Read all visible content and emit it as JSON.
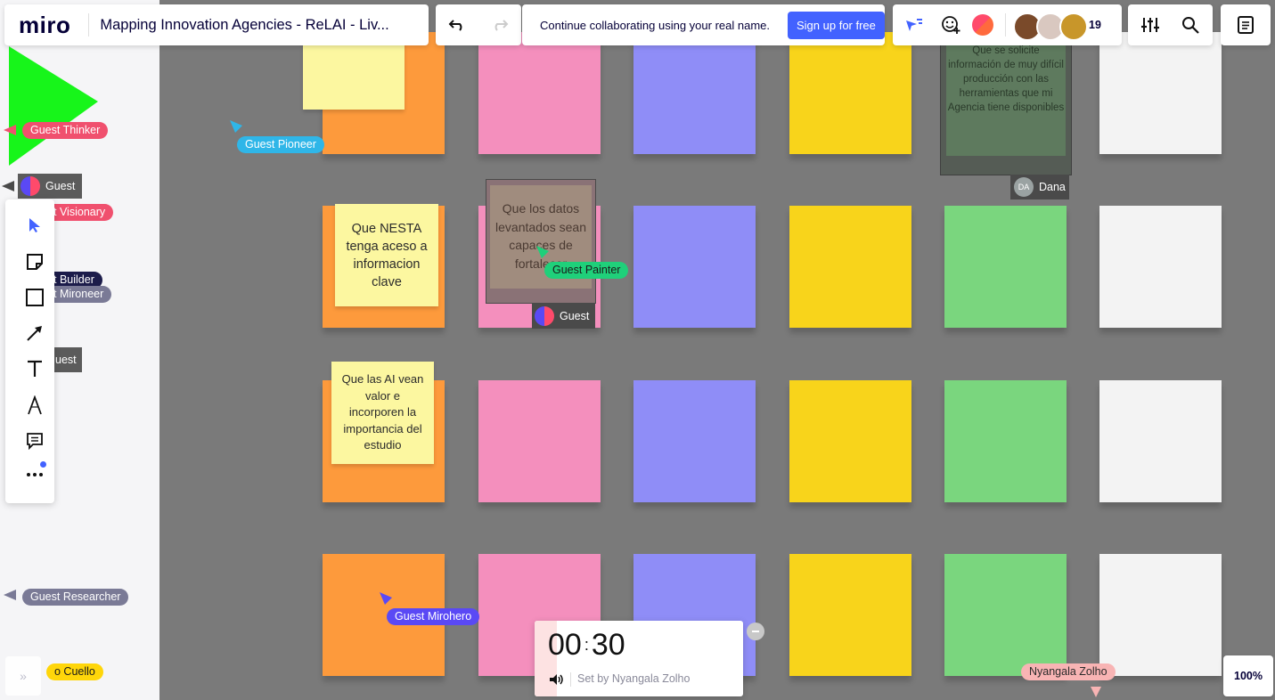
{
  "app": {
    "logo": "miro",
    "board_title": "Mapping Innovation Agencies - ReLAI - Liv...",
    "banner_text": "Continue collaborating using your real name.",
    "signup_label": "Sign up for free",
    "online_count": "19",
    "zoom": "100%"
  },
  "icons": {
    "undo": "undo-icon",
    "redo": "redo-icon",
    "reaction": "reaction-icon",
    "settings": "sliders-icon",
    "search": "search-icon",
    "notes": "notes-icon"
  },
  "toolbar": [
    "select",
    "sticky-note",
    "shape",
    "arrow",
    "text",
    "pen",
    "comment",
    "more"
  ],
  "notes": {
    "nesta": "Que NESTA tenga aceso a informacion clave",
    "ai": "Que las AI vean valor e incorporen la importancia del estudio",
    "datos": "Que los datos levantados sean capaces de fortalecer",
    "solicite": "Que se solicite información de muy difícil producción con las herramientas que mi Agencia tiene disponibles"
  },
  "owner_labels": {
    "dana_initials": "DA",
    "dana": "Dana",
    "guest": "Guest"
  },
  "cursors": {
    "thinker": "Guest Thinker",
    "pioneer": "Guest Pioneer",
    "guest_left": "Guest",
    "visionary": "t Visionary",
    "builder": "t Builder",
    "mironeer": "t Mironeer",
    "guest_left2": "uest",
    "painter": "Guest Painter",
    "researcher": "Guest Researcher",
    "mirohero": "Guest Mirohero",
    "cuello": "o Cuello",
    "nyangala": "Nyangala Zolho"
  },
  "timer": {
    "minutes": "00",
    "seconds": "30",
    "set_by": "Set by Nyangala Zolho"
  },
  "colors": {
    "accent": "#4262ff",
    "orange": "#fd9a3c",
    "pink": "#f48fbd",
    "blue": "#8f8df7",
    "yellow": "#f8d41b",
    "green": "#7ad67e",
    "white": "#f3f3f3"
  }
}
